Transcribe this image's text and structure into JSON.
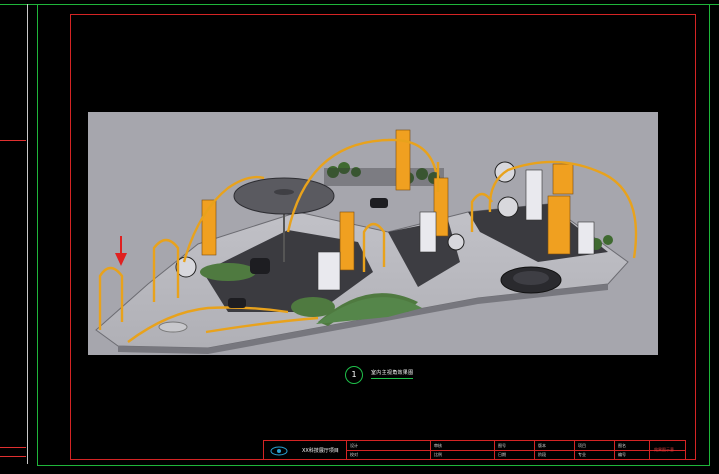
{
  "drawing": {
    "caption_number": "1",
    "caption_text": "室内主视角效果图"
  },
  "title_block": {
    "project_name": "XX科技展厅项目",
    "cells": [
      "设计",
      "校对",
      "审核",
      "比例",
      "图号",
      "日期",
      "版本",
      "阶段",
      "项目",
      "专业",
      "图名",
      "编号"
    ],
    "red_note": "效果图示意"
  },
  "colors": {
    "frame_green": "#1fb53a",
    "frame_red": "#d42424",
    "rail_yellow": "#e8a21c",
    "panel_orange": "#f0a020",
    "floor_grey": "#b4b4bb",
    "carpet_green": "#4f7a40",
    "background": "#a6a6ad"
  },
  "icons": [
    "arrow-down-icon",
    "logo-eye-icon"
  ]
}
